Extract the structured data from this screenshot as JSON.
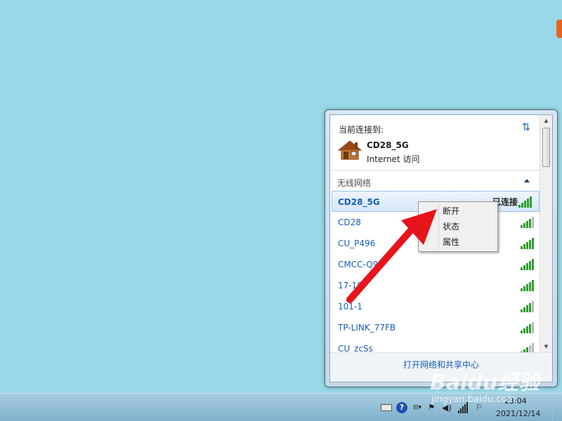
{
  "popup": {
    "current_connected_label": "当前连接到:",
    "connection": {
      "name": "CD28_5G",
      "access": "Internet 访问",
      "icon": "house-icon"
    },
    "wireless_section_label": "无线网络",
    "networks": [
      {
        "name": "CD28_5G",
        "status": "已连接"
      },
      {
        "name": "CD28",
        "status": ""
      },
      {
        "name": "CU_P496",
        "status": ""
      },
      {
        "name": "CMCC-Q9D",
        "status": ""
      },
      {
        "name": "17-10",
        "status": ""
      },
      {
        "name": "101-1",
        "status": ""
      },
      {
        "name": "TP-LINK_77FB",
        "status": ""
      },
      {
        "name": "CU_zcSs",
        "status": ""
      }
    ],
    "footer_link": "打开网络和共享中心"
  },
  "context_menu": {
    "items": [
      "断开",
      "状态",
      "属性"
    ]
  },
  "taskbar": {
    "time": "23:04",
    "date": "2021/12/14",
    "tray_icons": [
      "keyboard-icon",
      "help-icon",
      "show-hidden-icon",
      "flag-icon",
      "volume-icon",
      "network-icon",
      "action-center-icon"
    ]
  },
  "watermark": {
    "logo_text": "Baidu经验",
    "url": "jingyan.baidu.com"
  },
  "colors": {
    "desktop": "#99d8e6",
    "link": "#1a5fb4",
    "arrow": "#e8141b",
    "signal": "#2f9e2f"
  }
}
